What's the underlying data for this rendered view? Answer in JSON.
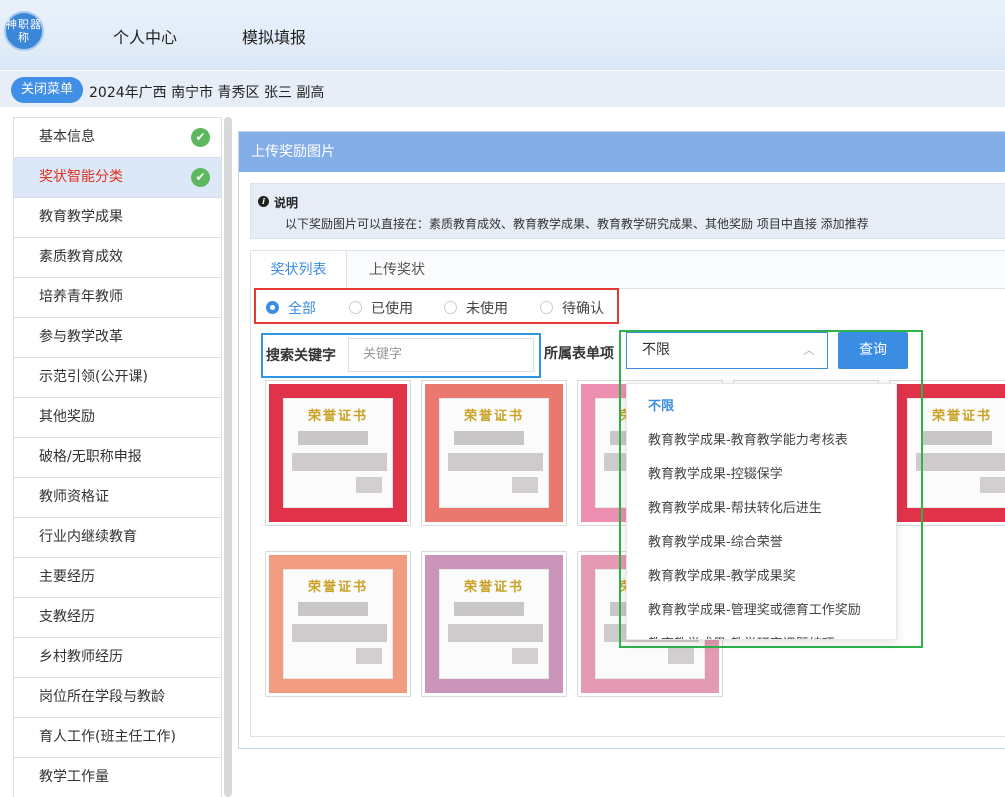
{
  "header": {
    "logo_text": "神职器称",
    "nav": [
      "个人中心",
      "模拟填报"
    ]
  },
  "breadcrumb": {
    "close_menu": "关闭菜单",
    "path": "2024年广西 南宁市 青秀区 张三 副高"
  },
  "sidebar": {
    "items": [
      {
        "label": "基本信息",
        "done": true
      },
      {
        "label": "奖状智能分类",
        "done": true,
        "active": true
      },
      {
        "label": "教育教学成果"
      },
      {
        "label": "素质教育成效"
      },
      {
        "label": "培养青年教师"
      },
      {
        "label": "参与教学改革"
      },
      {
        "label": "示范引领(公开课)"
      },
      {
        "label": "其他奖励"
      },
      {
        "label": "破格/无职称申报"
      },
      {
        "label": "教师资格证"
      },
      {
        "label": "行业内继续教育"
      },
      {
        "label": "主要经历"
      },
      {
        "label": "支教经历"
      },
      {
        "label": "乡村教师经历"
      },
      {
        "label": "岗位所在学段与教龄"
      },
      {
        "label": "育人工作(班主任工作)"
      },
      {
        "label": "教学工作量"
      }
    ]
  },
  "panel": {
    "title": "上传奖励图片",
    "notice_title": "说明",
    "notice_body": "以下奖励图片可以直接在：素质教育成效、教育教学成果、教育教学研究成果、其他奖励 项目中直接 添加推荐",
    "tabs": [
      "奖状列表",
      "上传奖状"
    ],
    "filters": [
      "全部",
      "已使用",
      "未使用",
      "待确认"
    ],
    "search_label": "搜索关键字",
    "search_placeholder": "关键字",
    "category_label": "所属表单项",
    "category_value": "不限",
    "query_button": "查询",
    "options": [
      "不限",
      "教育教学成果-教育教学能力考核表",
      "教育教学成果-控辍保学",
      "教育教学成果-帮扶转化后进生",
      "教育教学成果-综合荣誉",
      "教育教学成果-教学成果奖",
      "教育教学成果-管理奖或德育工作奖励",
      "教育教学成果-教学研究课题结项"
    ],
    "certificate_title": "荣誉证书",
    "certificates": [
      {
        "frame": "#e0334a"
      },
      {
        "frame": "#e9786f"
      },
      {
        "frame": "#ec8fb0"
      },
      {
        "frame": "#e9a0b4"
      },
      {
        "frame": "#e0334a"
      },
      {
        "frame": "#f19b80"
      },
      {
        "frame": "#c995b8"
      },
      {
        "frame": "#e39ab2"
      }
    ]
  }
}
